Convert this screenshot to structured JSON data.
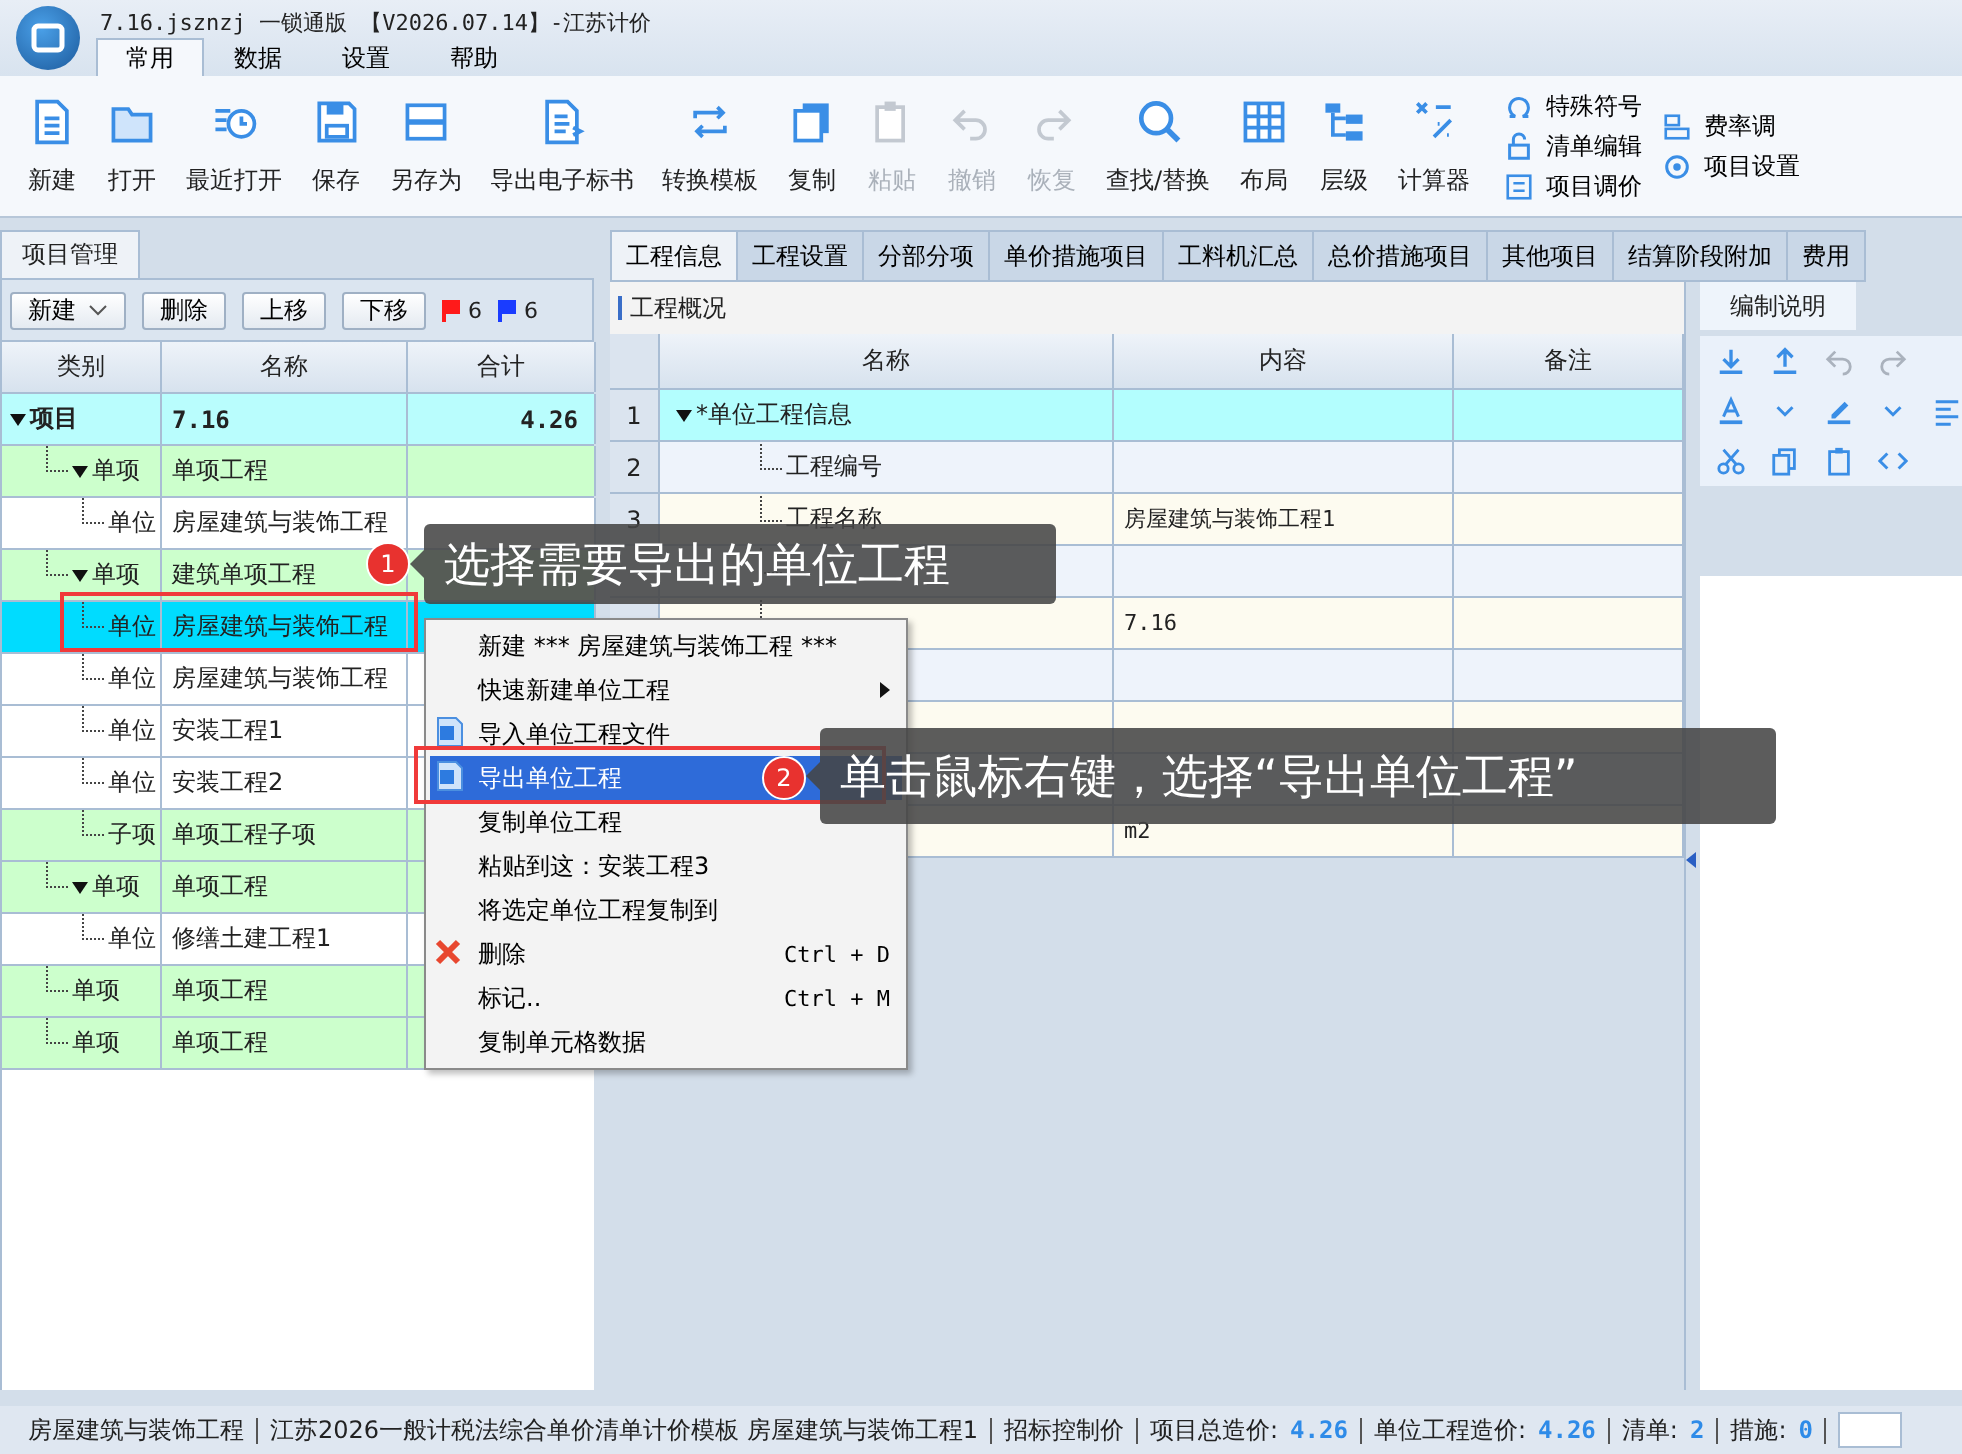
{
  "window": {
    "title": "7.16.jsznzj 一锁通版 【V2026.07.14】-江苏计价"
  },
  "menu_tabs": [
    {
      "label": "常用",
      "selected": true
    },
    {
      "label": "数据",
      "selected": false
    },
    {
      "label": "设置",
      "selected": false
    },
    {
      "label": "帮助",
      "selected": false
    }
  ],
  "toolbar": [
    {
      "label": "新建",
      "disabled": false
    },
    {
      "label": "打开",
      "disabled": false
    },
    {
      "label": "最近打开",
      "disabled": false
    },
    {
      "label": "保存",
      "disabled": false
    },
    {
      "label": "另存为",
      "disabled": false
    },
    {
      "label": "导出电子标书",
      "disabled": false
    },
    {
      "label": "转换模板",
      "disabled": false
    },
    {
      "label": "复制",
      "disabled": false
    },
    {
      "label": "粘贴",
      "disabled": true
    },
    {
      "label": "撤销",
      "disabled": true
    },
    {
      "label": "恢复",
      "disabled": true
    },
    {
      "label": "查找/替换",
      "disabled": false
    },
    {
      "label": "布局",
      "disabled": false
    },
    {
      "label": "层级",
      "disabled": false
    },
    {
      "label": "计算器",
      "disabled": false
    }
  ],
  "toolbar_small": [
    {
      "label": "特殊符号"
    },
    {
      "label": "清单编辑"
    },
    {
      "label": "项目调价"
    },
    {
      "label": "费率调"
    },
    {
      "label": "项目设置"
    }
  ],
  "left_panel": {
    "tab": "项目管理",
    "buttons": [
      {
        "label": "新建",
        "kind": "dropdown"
      },
      {
        "label": "删除",
        "kind": "plain"
      },
      {
        "label": "上移",
        "kind": "plain"
      },
      {
        "label": "下移",
        "kind": "plain"
      }
    ],
    "flags": [
      {
        "color": "#ff1a1a",
        "count": "6"
      },
      {
        "color": "#1a3cff",
        "count": "6"
      }
    ]
  },
  "tree": {
    "columns": [
      "类别",
      "名称",
      "合计"
    ],
    "rows": [
      {
        "kind": "project",
        "category": "项目",
        "name": "7.16",
        "total": "4.26",
        "expanded": true,
        "selected": false,
        "children": [
          {
            "kind": "section",
            "category": "单项",
            "name": "单项工程",
            "expanded": true,
            "selected": false,
            "children": [
              {
                "kind": "unit",
                "category": "单位",
                "name": "房屋建筑与装饰工程",
                "expanded": false,
                "selected": false
              }
            ]
          },
          {
            "kind": "section",
            "category": "单项",
            "name": "建筑单项工程",
            "expanded": true,
            "selected": false,
            "children": [
              {
                "kind": "unit",
                "category": "单位",
                "name": "房屋建筑与装饰工程",
                "expanded": false,
                "selected": true
              },
              {
                "kind": "unit",
                "category": "单位",
                "name": "房屋建筑与装饰工程",
                "expanded": false,
                "selected": false
              },
              {
                "kind": "unit",
                "category": "单位",
                "name": "安装工程1",
                "expanded": false,
                "selected": false
              },
              {
                "kind": "unit",
                "category": "单位",
                "name": "安装工程2",
                "expanded": false,
                "selected": false
              },
              {
                "kind": "section",
                "category": "子项",
                "name": "单项工程子项",
                "expanded": false,
                "selected": false
              }
            ]
          },
          {
            "kind": "section",
            "category": "单项",
            "name": "单项工程",
            "expanded": true,
            "selected": false,
            "children": [
              {
                "kind": "unit",
                "category": "单位",
                "name": "修缮土建工程1",
                "expanded": false,
                "selected": false
              }
            ]
          },
          {
            "kind": "section",
            "category": "单项",
            "name": "单项工程",
            "expanded": false,
            "selected": false
          },
          {
            "kind": "section",
            "category": "单项",
            "name": "单项工程",
            "expanded": false,
            "selected": false
          }
        ]
      }
    ]
  },
  "right_tabs": [
    {
      "label": "工程信息",
      "selected": true
    },
    {
      "label": "工程设置",
      "selected": false
    },
    {
      "label": "分部分项",
      "selected": false
    },
    {
      "label": "单价措施项目",
      "selected": false
    },
    {
      "label": "工料机汇总",
      "selected": false
    },
    {
      "label": "总价措施项目",
      "selected": false
    },
    {
      "label": "其他项目",
      "selected": false
    },
    {
      "label": "结算阶段附加",
      "selected": false
    },
    {
      "label": "费用",
      "selected": false
    }
  ],
  "section_title": "工程概况",
  "info_table": {
    "columns": [
      "名称",
      "内容",
      "备注"
    ],
    "rows": [
      {
        "kind": "group",
        "num": "1",
        "name": "*单位工程信息",
        "expanded": true
      },
      {
        "kind": "field",
        "num": "2",
        "name": "工程编号"
      },
      {
        "kind": "field",
        "num": "3",
        "name": "工程名称",
        "content": "房屋建筑与装饰工程1"
      },
      {
        "kind": "field"
      },
      {
        "kind": "field",
        "content": "7.16"
      },
      {
        "kind": "field"
      },
      {
        "kind": "field"
      },
      {
        "kind": "field"
      },
      {
        "kind": "field",
        "content": "m2"
      }
    ]
  },
  "side_panel": {
    "tab": "编制说明"
  },
  "context_menu": [
    {
      "kind": "plain",
      "label": "新建 *** 房屋建筑与装饰工程 ***",
      "selected": false
    },
    {
      "kind": "submenu",
      "label": "快速新建单位工程",
      "selected": false
    },
    {
      "kind": "import",
      "label": "导入单位工程文件",
      "selected": false
    },
    {
      "kind": "export",
      "label": "导出单位工程",
      "selected": true
    },
    {
      "kind": "plain",
      "label": "复制单位工程",
      "selected": false
    },
    {
      "kind": "plain",
      "label": "粘贴到这：安装工程3",
      "selected": false
    },
    {
      "kind": "plain",
      "label": "将选定单位工程复制到",
      "selected": false
    },
    {
      "kind": "delete",
      "label": "删除",
      "shortcut": "Ctrl + D",
      "selected": false
    },
    {
      "kind": "plain",
      "label": "标记..",
      "shortcut": "Ctrl + M",
      "selected": false
    },
    {
      "kind": "plain",
      "label": "复制单元格数据",
      "selected": false
    }
  ],
  "callouts": [
    {
      "number": "1",
      "text": "选择需要导出的单位工程"
    },
    {
      "number": "2",
      "text": "单击鼠标右键，选择“导出单位工程”"
    }
  ],
  "status_bar": [
    {
      "label": "房屋建筑与装饰工程"
    },
    {
      "label": "江苏2026一般计税法综合单价清单计价模板 房屋建筑与装饰工程1"
    },
    {
      "label": "招标控制价"
    },
    {
      "label": "项目总造价:",
      "value": "4.26"
    },
    {
      "label": "单位工程造价:",
      "value": "4.26"
    },
    {
      "label": "清单:",
      "value": "2"
    },
    {
      "label": "措施:",
      "value": "0"
    }
  ]
}
